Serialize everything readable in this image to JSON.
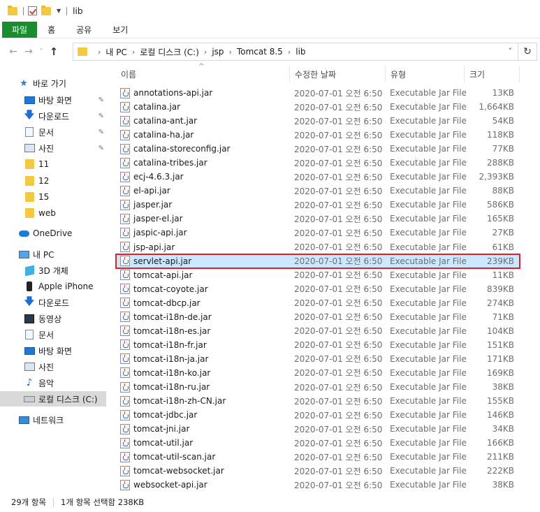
{
  "window": {
    "title": "lib"
  },
  "ribbon": {
    "tabs": [
      "파일",
      "홈",
      "공유",
      "보기"
    ]
  },
  "address": {
    "crumbs": [
      "내 PC",
      "로컬 디스크 (C:)",
      "jsp",
      "Tomcat 8.5",
      "lib"
    ]
  },
  "sidebar": {
    "quick_access": "바로 가기",
    "items": [
      {
        "label": "바탕 화면",
        "icon": "desktop-icon",
        "pinned": true
      },
      {
        "label": "다운로드",
        "icon": "download-icon",
        "pinned": true
      },
      {
        "label": "문서",
        "icon": "document-icon",
        "pinned": true
      },
      {
        "label": "사진",
        "icon": "pictures-icon",
        "pinned": true
      },
      {
        "label": "11",
        "icon": "folder-icon"
      },
      {
        "label": "12",
        "icon": "folder-icon"
      },
      {
        "label": "15",
        "icon": "folder-icon"
      },
      {
        "label": "web",
        "icon": "folder-icon"
      }
    ],
    "onedrive": "OneDrive",
    "this_pc": "내 PC",
    "pc_items": [
      {
        "label": "3D 개체",
        "icon": "3d-objects-icon"
      },
      {
        "label": "Apple iPhone",
        "icon": "phone-icon"
      },
      {
        "label": "다운로드",
        "icon": "download-icon"
      },
      {
        "label": "동영상",
        "icon": "video-icon"
      },
      {
        "label": "문서",
        "icon": "document-icon"
      },
      {
        "label": "바탕 화면",
        "icon": "desktop-icon"
      },
      {
        "label": "사진",
        "icon": "pictures-icon"
      },
      {
        "label": "음악",
        "icon": "music-icon"
      },
      {
        "label": "로컬 디스크 (C:)",
        "icon": "drive-icon",
        "selected": true
      }
    ],
    "network": "네트워크"
  },
  "columns": {
    "name": "이름",
    "date": "수정한 날짜",
    "type": "유형",
    "size": "크기"
  },
  "files": [
    {
      "name": "annotations-api.jar",
      "date": "2020-07-01 오전 6:50",
      "type": "Executable Jar File",
      "size": "13KB"
    },
    {
      "name": "catalina.jar",
      "date": "2020-07-01 오전 6:50",
      "type": "Executable Jar File",
      "size": "1,664KB"
    },
    {
      "name": "catalina-ant.jar",
      "date": "2020-07-01 오전 6:50",
      "type": "Executable Jar File",
      "size": "54KB"
    },
    {
      "name": "catalina-ha.jar",
      "date": "2020-07-01 오전 6:50",
      "type": "Executable Jar File",
      "size": "118KB"
    },
    {
      "name": "catalina-storeconfig.jar",
      "date": "2020-07-01 오전 6:50",
      "type": "Executable Jar File",
      "size": "77KB"
    },
    {
      "name": "catalina-tribes.jar",
      "date": "2020-07-01 오전 6:50",
      "type": "Executable Jar File",
      "size": "288KB"
    },
    {
      "name": "ecj-4.6.3.jar",
      "date": "2020-07-01 오전 6:50",
      "type": "Executable Jar File",
      "size": "2,393KB"
    },
    {
      "name": "el-api.jar",
      "date": "2020-07-01 오전 6:50",
      "type": "Executable Jar File",
      "size": "88KB"
    },
    {
      "name": "jasper.jar",
      "date": "2020-07-01 오전 6:50",
      "type": "Executable Jar File",
      "size": "586KB"
    },
    {
      "name": "jasper-el.jar",
      "date": "2020-07-01 오전 6:50",
      "type": "Executable Jar File",
      "size": "165KB"
    },
    {
      "name": "jaspic-api.jar",
      "date": "2020-07-01 오전 6:50",
      "type": "Executable Jar File",
      "size": "27KB"
    },
    {
      "name": "jsp-api.jar",
      "date": "2020-07-01 오전 6:50",
      "type": "Executable Jar File",
      "size": "61KB"
    },
    {
      "name": "servlet-api.jar",
      "date": "2020-07-01 오전 6:50",
      "type": "Executable Jar File",
      "size": "239KB",
      "selected": true
    },
    {
      "name": "tomcat-api.jar",
      "date": "2020-07-01 오전 6:50",
      "type": "Executable Jar File",
      "size": "11KB"
    },
    {
      "name": "tomcat-coyote.jar",
      "date": "2020-07-01 오전 6:50",
      "type": "Executable Jar File",
      "size": "839KB"
    },
    {
      "name": "tomcat-dbcp.jar",
      "date": "2020-07-01 오전 6:50",
      "type": "Executable Jar File",
      "size": "274KB"
    },
    {
      "name": "tomcat-i18n-de.jar",
      "date": "2020-07-01 오전 6:50",
      "type": "Executable Jar File",
      "size": "71KB"
    },
    {
      "name": "tomcat-i18n-es.jar",
      "date": "2020-07-01 오전 6:50",
      "type": "Executable Jar File",
      "size": "104KB"
    },
    {
      "name": "tomcat-i18n-fr.jar",
      "date": "2020-07-01 오전 6:50",
      "type": "Executable Jar File",
      "size": "151KB"
    },
    {
      "name": "tomcat-i18n-ja.jar",
      "date": "2020-07-01 오전 6:50",
      "type": "Executable Jar File",
      "size": "171KB"
    },
    {
      "name": "tomcat-i18n-ko.jar",
      "date": "2020-07-01 오전 6:50",
      "type": "Executable Jar File",
      "size": "169KB"
    },
    {
      "name": "tomcat-i18n-ru.jar",
      "date": "2020-07-01 오전 6:50",
      "type": "Executable Jar File",
      "size": "38KB"
    },
    {
      "name": "tomcat-i18n-zh-CN.jar",
      "date": "2020-07-01 오전 6:50",
      "type": "Executable Jar File",
      "size": "155KB"
    },
    {
      "name": "tomcat-jdbc.jar",
      "date": "2020-07-01 오전 6:50",
      "type": "Executable Jar File",
      "size": "146KB"
    },
    {
      "name": "tomcat-jni.jar",
      "date": "2020-07-01 오전 6:50",
      "type": "Executable Jar File",
      "size": "34KB"
    },
    {
      "name": "tomcat-util.jar",
      "date": "2020-07-01 오전 6:50",
      "type": "Executable Jar File",
      "size": "166KB"
    },
    {
      "name": "tomcat-util-scan.jar",
      "date": "2020-07-01 오전 6:50",
      "type": "Executable Jar File",
      "size": "211KB"
    },
    {
      "name": "tomcat-websocket.jar",
      "date": "2020-07-01 오전 6:50",
      "type": "Executable Jar File",
      "size": "222KB"
    },
    {
      "name": "websocket-api.jar",
      "date": "2020-07-01 오전 6:50",
      "type": "Executable Jar File",
      "size": "38KB"
    }
  ],
  "status": {
    "item_count": "29개 항목",
    "selection": "1개 항목 선택함 238KB"
  },
  "colors": {
    "accent_file_tab": "#1b8c2f",
    "selection_bg": "#cce8ff",
    "highlight_border": "#e01f2e"
  }
}
